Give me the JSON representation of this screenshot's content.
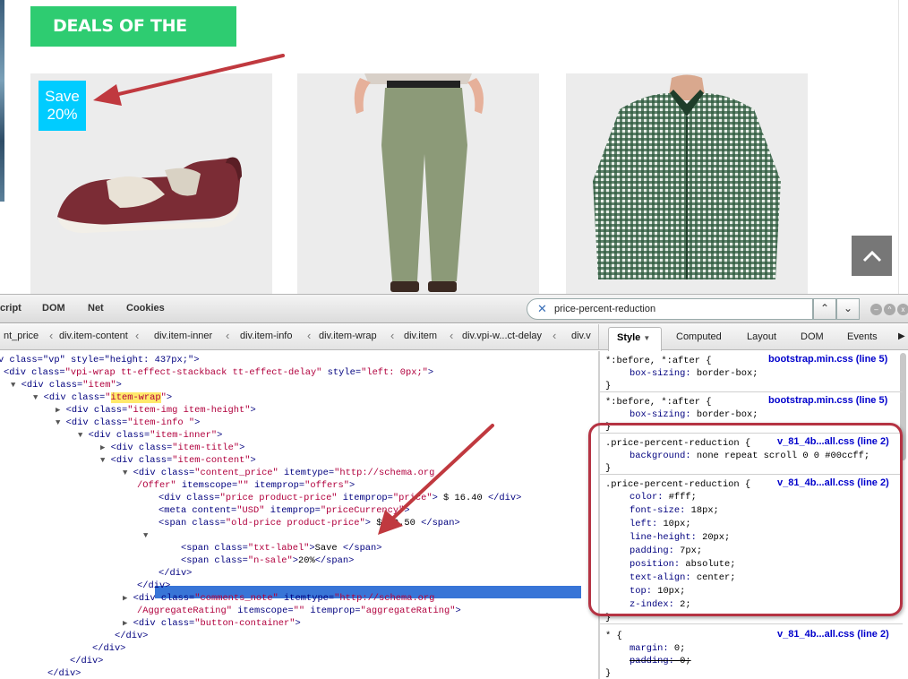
{
  "site": {
    "deals_heading": "DEALS OF THE WEEK",
    "badge_line1": "Save",
    "badge_line2": "20%",
    "products": [
      "shoe",
      "trousers",
      "shirt"
    ]
  },
  "colors": {
    "deals_green": "#2ecc71",
    "badge_cyan": "#00ccff",
    "selection_blue": "#3875d7",
    "annotation_red": "#b53343"
  },
  "toolbar": {
    "tabs": [
      "cript",
      "DOM",
      "Net",
      "Cookies"
    ],
    "search_value": "price-percent-reduction"
  },
  "breadcrumbs": [
    "nt_price",
    "div.item-content",
    "div.item-inner",
    "div.item-info",
    "div.item-wrap",
    "div.item",
    "div.vpi-w...ct-delay",
    "div.v"
  ],
  "side_tabs": [
    "Style",
    "Computed",
    "Layout",
    "DOM",
    "Events"
  ],
  "html_tree": {
    "l1": "v class=\"vp\" style=\"height: 437px;\">",
    "l2_a": "<div class=",
    "l2_b": "\"vpi-wrap tt-effect-stackback tt-effect-delay\"",
    "l2_c": " style=",
    "l2_d": "\"left: 0px;\"",
    "l2_e": ">",
    "item": "\"item\"",
    "item_wrap": "item-wrap",
    "item_img": "\"item-img item-height\"",
    "item_info": "\"item-info \"",
    "item_inner": "\"item-inner\"",
    "item_title": "\"item-title\"",
    "item_content": "\"item-content\"",
    "content_price": "\"content_price\"",
    "itemtype_offer": "\"http://schema.org",
    "offer_cont": "/Offer\"",
    "itemscope_empty": "\"\"",
    "offers": "\"offers\"",
    "price_cls": "\"price product-price\"",
    "price_prop": "\"price\"",
    "price_text": " $ 16.40 ",
    "meta_content": "\"USD\"",
    "price_currency": "\"priceCurrency\"",
    "old_price_cls": "\"old-price product-price\"",
    "old_price_text": " $ 20.50 ",
    "ppr": "\"price-percent-reduction\"",
    "txt_label": "\"txt-label\"",
    "save_text": "Save ",
    "n_sale": "\"n-sale\"",
    "pct_text": "20%",
    "comments_note": "\"comments_note\"",
    "itemtype_rating": "\"http://schema.org",
    "rating_cont": "/AggregateRating\"",
    "aggregate_rating": "\"aggregateRating\"",
    "button_container": "\"button-container\""
  },
  "css_rules": [
    {
      "selector": "*:before, *:after {",
      "source": "bootstrap.min.css (line 5)",
      "props": [
        [
          "box-sizing",
          "border-box;"
        ]
      ]
    },
    {
      "selector": "*:before, *:after {",
      "source": "bootstrap.min.css (line 5)",
      "props": [
        [
          "box-sizing",
          "border-box;"
        ]
      ]
    },
    {
      "selector": ".price-percent-reduction {",
      "source": "v_81_4b...all.css (line 2)",
      "props": [
        [
          "background",
          "none repeat scroll 0 0 #00ccff;"
        ]
      ]
    },
    {
      "selector": ".price-percent-reduction {",
      "source": "v_81_4b...all.css (line 2)",
      "props": [
        [
          "color",
          "#fff;"
        ],
        [
          "font-size",
          "18px;"
        ],
        [
          "left",
          "10px;"
        ],
        [
          "line-height",
          "20px;"
        ],
        [
          "padding",
          "7px;"
        ],
        [
          "position",
          "absolute;"
        ],
        [
          "text-align",
          "center;"
        ],
        [
          "top",
          "10px;"
        ],
        [
          "z-index",
          "2;"
        ]
      ]
    },
    {
      "selector": "* {",
      "source": "v_81_4b...all.css (line 2)",
      "props": [
        [
          "margin",
          "0;"
        ],
        [
          "padding",
          "0;"
        ]
      ]
    }
  ]
}
